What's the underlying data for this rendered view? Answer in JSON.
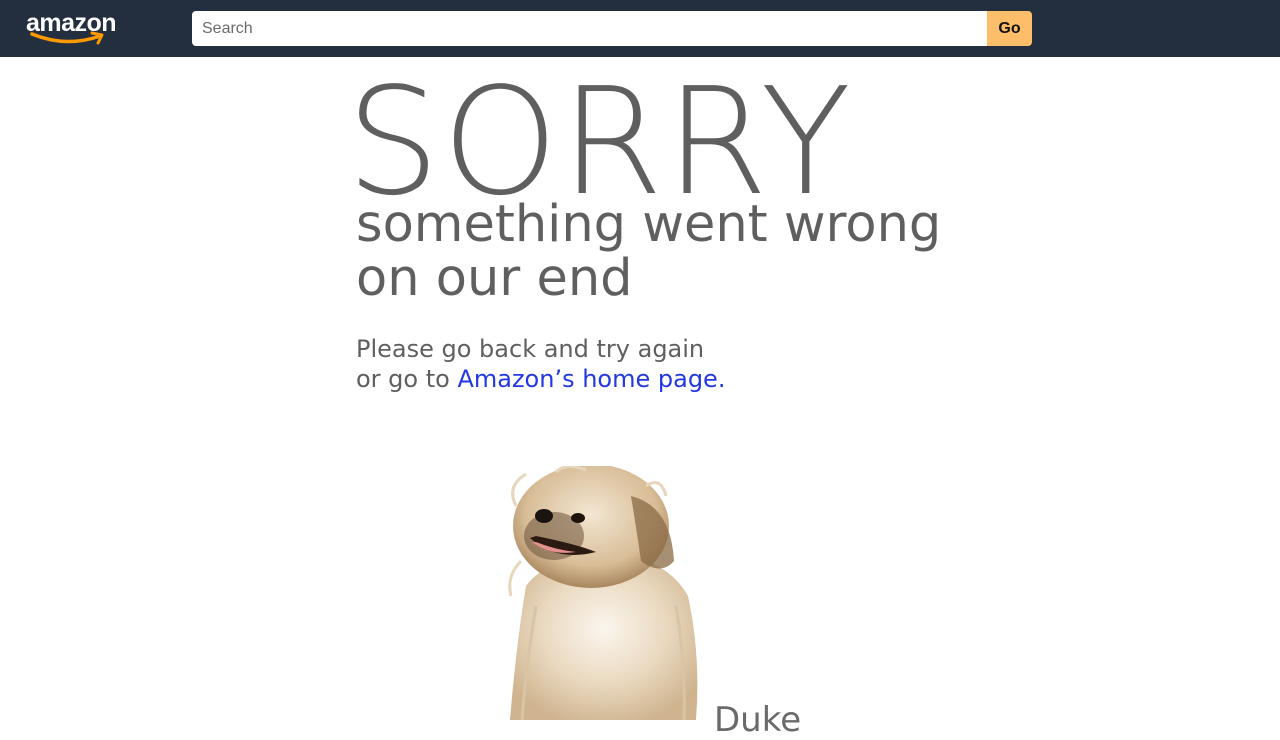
{
  "header": {
    "logo_text": "amazon",
    "search": {
      "placeholder": "Search",
      "value": ""
    },
    "go_label": "Go"
  },
  "main": {
    "sorry": "SORRY",
    "subhead_line1": "something went wrong",
    "subhead_line2": "on our end",
    "message_line1": "Please go back and try again",
    "message_line2_prefix": "or go to ",
    "home_link": "Amazon’s home page.",
    "dog_name": "Duke"
  },
  "colors": {
    "header_bg": "#232f3e",
    "go_button": "#febd69",
    "logo_smile": "#ff9900",
    "text_gray": "#5f5f5f",
    "link_blue": "#2239e0"
  },
  "icons": {
    "logo": "amazon-logo",
    "dog": "dog-photo"
  }
}
